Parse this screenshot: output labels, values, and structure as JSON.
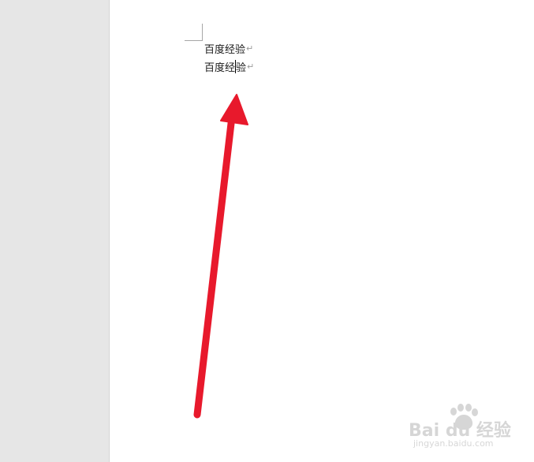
{
  "document": {
    "lines": [
      {
        "text": "百度经验",
        "para_mark": "↵"
      },
      {
        "text_before_caret": "百度经",
        "text_after_caret": "验",
        "para_mark": "↵"
      }
    ]
  },
  "annotation": {
    "arrow_color": "#e8192c"
  },
  "watermark": {
    "brand": "Bai du 经验",
    "url": "jingyan.baidu.com"
  },
  "colors": {
    "sidebar_bg": "#e6e6e6",
    "page_bg": "#ffffff",
    "text": "#1a1a1a"
  }
}
